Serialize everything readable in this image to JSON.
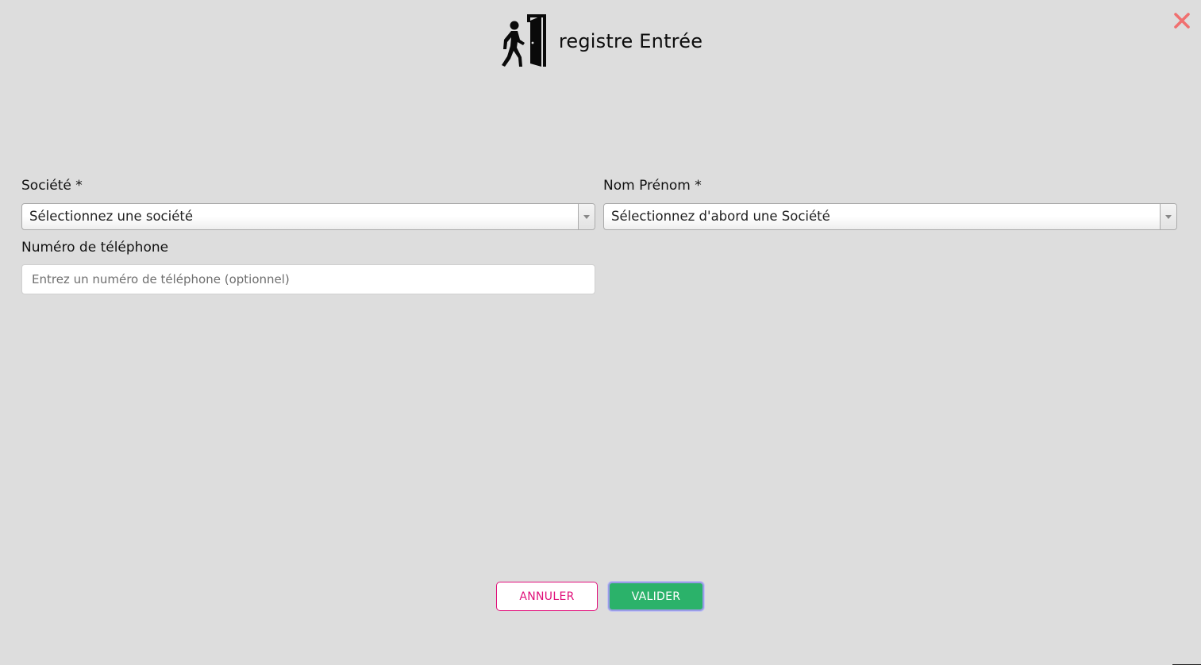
{
  "header": {
    "title": "registre Entrée",
    "icon": "person-entering-door-icon"
  },
  "close": {
    "icon": "close-icon",
    "color": "#f07070"
  },
  "form": {
    "company": {
      "label": "Société *",
      "value": "Sélectionnez une société"
    },
    "name": {
      "label": "Nom Prénom *",
      "value": "Sélectionnez d'abord une Société"
    },
    "phone": {
      "label": "Numéro de téléphone",
      "value": "",
      "placeholder": "Entrez un numéro de téléphone (optionnel)"
    }
  },
  "actions": {
    "cancel_label": "ANNULER",
    "submit_label": "VALIDER"
  },
  "colors": {
    "background": "#dddddd",
    "cancel_accent": "#e0107a",
    "submit_bg": "#2bb26a",
    "submit_focus_ring": "#9a9ce6"
  }
}
